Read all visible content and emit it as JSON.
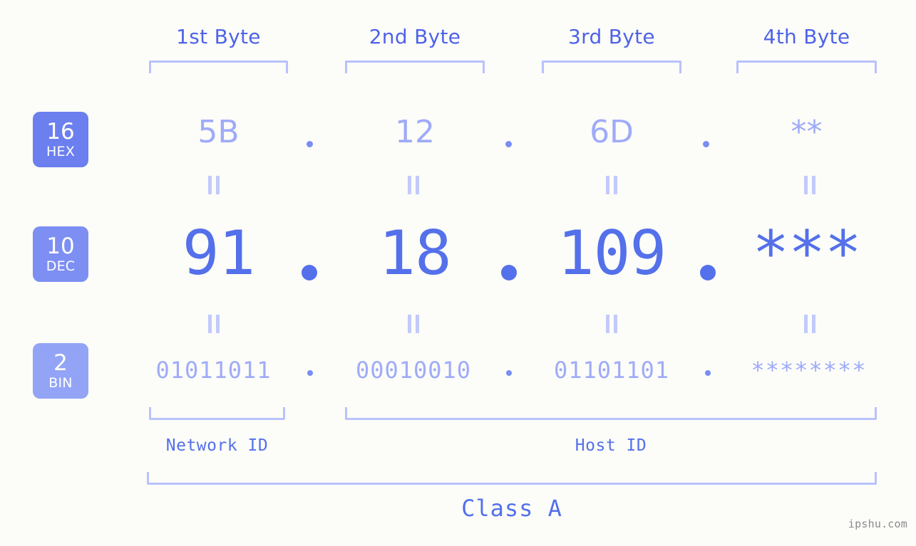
{
  "background_color": "#fcfdf9",
  "accent_colors": {
    "header_text": "#4f63e8",
    "bracket": "#b9c2fb",
    "dec_value": "#5470ea",
    "muted_value": "#9fabf8",
    "badge_hex": "#6b7fef",
    "badge_dec": "#7d8ff2",
    "badge_bin": "#93a4f6",
    "watermark": "#8a8a8a"
  },
  "headers": [
    {
      "label": "1st Byte"
    },
    {
      "label": "2nd Byte"
    },
    {
      "label": "3rd Byte"
    },
    {
      "label": "4th Byte"
    }
  ],
  "bases": [
    {
      "number": "16",
      "name": "HEX"
    },
    {
      "number": "10",
      "name": "DEC"
    },
    {
      "number": "2",
      "name": "BIN"
    }
  ],
  "rows": {
    "hex": {
      "values": [
        "5B",
        "12",
        "6D",
        "**"
      ]
    },
    "dec": {
      "values": [
        "91",
        "18",
        "109",
        "***"
      ]
    },
    "bin": {
      "values": [
        "01011011",
        "00010010",
        "01101101",
        "********"
      ]
    }
  },
  "separator": ".",
  "equals_symbol": "=",
  "segments": {
    "network_id": "Network ID",
    "host_id": "Host ID",
    "class": "Class A"
  },
  "watermark": "ipshu.com"
}
